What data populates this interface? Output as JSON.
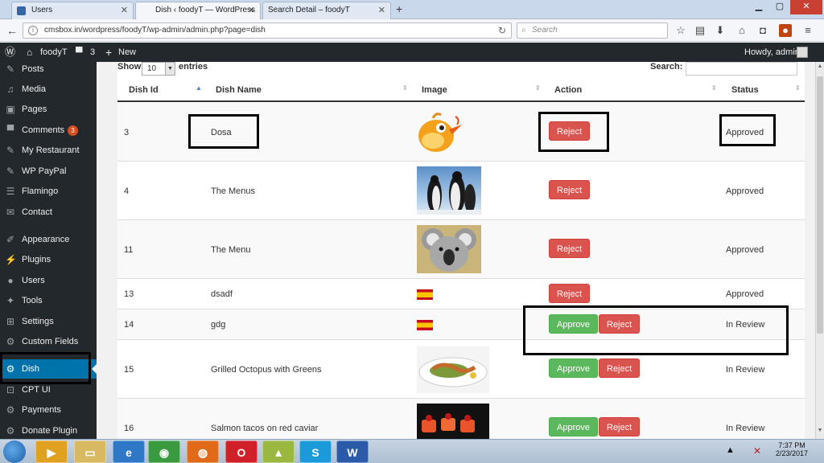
{
  "browser": {
    "tabs": [
      {
        "label": "Users",
        "active": false
      },
      {
        "label": "Dish ‹ foodyT — WordPress",
        "active": true
      },
      {
        "label": "Search Detail – foodyT",
        "active": false
      }
    ],
    "new_tab": "+",
    "url": "cmsbox.in/wordpress/foodyT/wp-admin/admin.php?page=dish",
    "search_placeholder": "Search"
  },
  "adminbar": {
    "site_name": "foodyT",
    "comments_count": "3",
    "new_label": "New",
    "howdy": "Howdy, admin"
  },
  "sidebar": {
    "items": [
      {
        "label": "Posts",
        "icon": "pin-icon"
      },
      {
        "label": "Media",
        "icon": "media-icon"
      },
      {
        "label": "Pages",
        "icon": "pages-icon"
      },
      {
        "label": "Comments",
        "icon": "comments-icon",
        "badge": "3"
      },
      {
        "label": "My Restaurant",
        "icon": "pin-icon"
      },
      {
        "label": "WP PayPal",
        "icon": "pin-icon"
      },
      {
        "label": "Flamingo",
        "icon": "flamingo-icon"
      },
      {
        "label": "Contact",
        "icon": "mail-icon"
      },
      {
        "label": "Appearance",
        "icon": "brush-icon"
      },
      {
        "label": "Plugins",
        "icon": "plugin-icon"
      },
      {
        "label": "Users",
        "icon": "users-icon"
      },
      {
        "label": "Tools",
        "icon": "wrench-icon"
      },
      {
        "label": "Settings",
        "icon": "settings-icon"
      },
      {
        "label": "Custom Fields",
        "icon": "gear-icon"
      },
      {
        "label": "Dish",
        "icon": "gear-icon",
        "active": true
      },
      {
        "label": "CPT UI",
        "icon": "cpt-icon"
      },
      {
        "label": "Payments",
        "icon": "gear-icon"
      },
      {
        "label": "Donate Plugin",
        "icon": "gear-icon"
      }
    ]
  },
  "table": {
    "show_label": "Show",
    "entries_value": "10",
    "entries_label": "entries",
    "search_label": "Search:",
    "headers": {
      "id": "Dish Id",
      "name": "Dish Name",
      "image": "Image",
      "action": "Action",
      "status": "Status"
    },
    "rows": [
      {
        "id": "3",
        "name": "Dosa",
        "image": "bird-image",
        "status": "Approved"
      },
      {
        "id": "4",
        "name": "The Menus",
        "image": "penguins-image",
        "status": "Approved"
      },
      {
        "id": "11",
        "name": "The Menu",
        "image": "koala-image",
        "status": "Approved"
      },
      {
        "id": "13",
        "name": "dsadf",
        "image": "spain-flag-image",
        "status": "Approved"
      },
      {
        "id": "14",
        "name": "gdg",
        "image": "spain-flag-image",
        "status": "In Review"
      },
      {
        "id": "15",
        "name": "Grilled Octopus with Greens",
        "image": "octopus-dish-image",
        "status": "In Review"
      },
      {
        "id": "16",
        "name": "Salmon tacos on red caviar",
        "image": "salmon-tacos-image",
        "status": "In Review"
      }
    ],
    "approve_label": "Approve",
    "reject_label": "Reject"
  },
  "taskbar": {
    "time": "7:37 PM",
    "date": "2/23/2017"
  },
  "colors": {
    "wp_dark": "#23282d",
    "wp_blue": "#0073aa",
    "reject": "#d9534f",
    "approve": "#5cb85c"
  }
}
